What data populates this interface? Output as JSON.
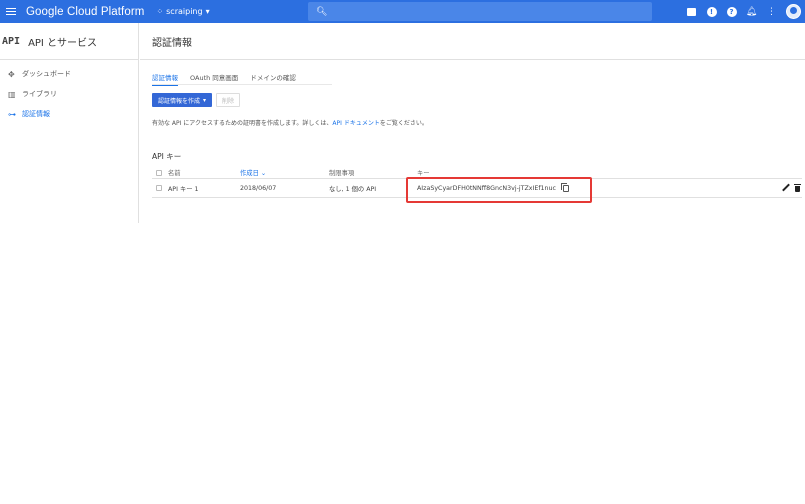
{
  "topbar": {
    "brand": "Google Cloud Platform",
    "project": "scraiping",
    "project_icon": "project-dots-icon",
    "search_icon": "search-icon",
    "right_icons": [
      "cloud-shell-icon",
      "notifications-alerts-icon",
      "help-icon",
      "bell-icon",
      "more-vert-icon",
      "account-avatar"
    ]
  },
  "sidebar": {
    "badge": "API",
    "title": "API とサービス",
    "items": [
      {
        "icon": "dashboard-icon",
        "label": "ダッシュボード",
        "active": false
      },
      {
        "icon": "library-icon",
        "label": "ライブラリ",
        "active": false
      },
      {
        "icon": "key-icon",
        "label": "認証情報",
        "active": true
      }
    ]
  },
  "main": {
    "title": "認証情報",
    "tabs": [
      {
        "label": "認証情報",
        "active": true
      },
      {
        "label": "OAuth 同意画面",
        "active": false
      },
      {
        "label": "ドメインの確認",
        "active": false
      }
    ],
    "create_button": "認証情報を作成",
    "delete_button": "削除",
    "description_prefix": "有効な API にアクセスするための証明書を作成します。詳しくは、",
    "description_link": "API ドキュメント",
    "description_suffix": "をご覧ください。",
    "section_title": "API キー",
    "table": {
      "headers": {
        "name": "名前",
        "created": "作成日",
        "restrictions": "制限事項",
        "key": "キー"
      },
      "rows": [
        {
          "name": "API キー 1",
          "created": "2018/06/07",
          "restrictions": "なし, 1 個の API",
          "key": "AIzaSyCyarDFH0tNNff8GncN3vj-jTZxIEf1nuc"
        }
      ]
    }
  },
  "colors": {
    "topbar": "#2c6fe0",
    "accent": "#1a73e8",
    "highlight": "#e53935"
  }
}
